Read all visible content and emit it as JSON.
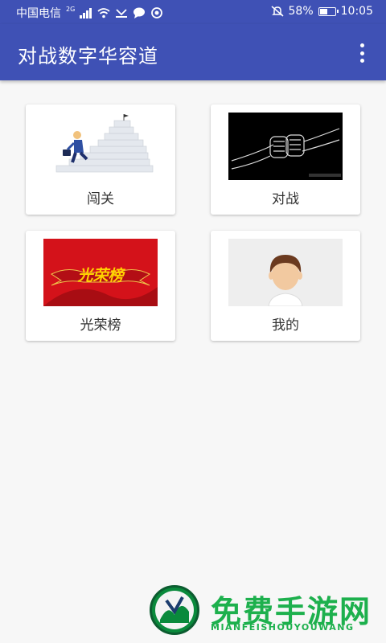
{
  "status_bar": {
    "carrier": "中国电信",
    "network": "2G",
    "battery": "58%",
    "battery_level": 0.58,
    "time": "10:05"
  },
  "app_bar": {
    "title": "对战数字华容道"
  },
  "menu": [
    {
      "label": "闯关",
      "icon": "climbing-stairs-image"
    },
    {
      "label": "对战",
      "icon": "fist-bump-image"
    },
    {
      "label": "光荣榜",
      "icon": "honor-banner-image",
      "image_text": "光荣榜"
    },
    {
      "label": "我的",
      "icon": "avatar-image"
    }
  ],
  "watermark": {
    "title": "免费手游网",
    "subtitle": "MIANFEISHOUYOUWANG"
  },
  "colors": {
    "primary": "#3f51b5",
    "background": "#f7f7f7",
    "banner_red": "#d4121a",
    "watermark_green": "#1db04d"
  }
}
